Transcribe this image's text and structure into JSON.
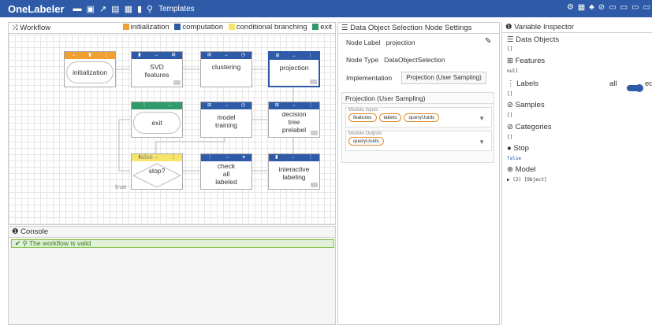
{
  "app": {
    "title": "OneLabeler",
    "templates_label": "Templates"
  },
  "toolbar": {
    "icons": [
      "folder-icon",
      "save-icon",
      "share-icon",
      "copy-icon",
      "paste-icon",
      "delete-icon",
      "template-icon"
    ]
  },
  "workflow": {
    "title": "Workflow",
    "legend": [
      {
        "label": "initialization",
        "color": "#f0a030"
      },
      {
        "label": "computation",
        "color": "#2e5aa7"
      },
      {
        "label": "conditional branching",
        "color": "#f7e46a"
      },
      {
        "label": "exit",
        "color": "#2f9a6a"
      }
    ],
    "nodes": [
      {
        "id": "initialization",
        "label": "initialization",
        "kind": "initialization"
      },
      {
        "id": "svd",
        "label": "SVD\nfeatures",
        "kind": "computation"
      },
      {
        "id": "clustering",
        "label": "clustering",
        "kind": "computation"
      },
      {
        "id": "projection",
        "label": "projection",
        "kind": "computation"
      },
      {
        "id": "exit",
        "label": "exit",
        "kind": "exit"
      },
      {
        "id": "model",
        "label": "model\ntraining",
        "kind": "computation"
      },
      {
        "id": "dtree",
        "label": "decision\ntree\nprelabel",
        "kind": "computation"
      },
      {
        "id": "stop",
        "label": "stop?",
        "kind": "conditional branching"
      },
      {
        "id": "check",
        "label": "check\nall\nlabeled",
        "kind": "computation"
      },
      {
        "id": "interactive",
        "label": "interactive\nlabeling",
        "kind": "computation"
      }
    ],
    "edge_labels": {
      "false": "false",
      "true": "true"
    }
  },
  "console": {
    "title": "Console",
    "message": "The workflow is valid"
  },
  "settings": {
    "title": "Data Object Selection Node Settings",
    "node_label_caption": "Node Label",
    "node_label_value": "projection",
    "node_type_caption": "Node Type",
    "node_type_value": "DataObjectSelection",
    "implementation_caption": "Implementation",
    "implementation_value": "Projection (User Sampling)",
    "section_title": "Projection (User Sampling)",
    "inputs_caption": "Module Inputs",
    "inputs": [
      "features",
      "labels",
      "queryUuids"
    ],
    "outputs_caption": "Module Outputs",
    "outputs": [
      "queryUuids"
    ]
  },
  "inspector": {
    "title": "Variable Inspector",
    "data_objects": "Data Objects",
    "data_objects_val": "[]",
    "features": "Features",
    "features_val": "null",
    "labels": "Labels",
    "labels_val": "[]",
    "labels_filter": "all",
    "labels_toggle": "edite",
    "samples": "Samples",
    "samples_val": "[]",
    "categories": "Categories",
    "categories_val": "[]",
    "stop": "Stop",
    "stop_val": "false",
    "model": "Model",
    "model_val": "(2) [Object]"
  }
}
